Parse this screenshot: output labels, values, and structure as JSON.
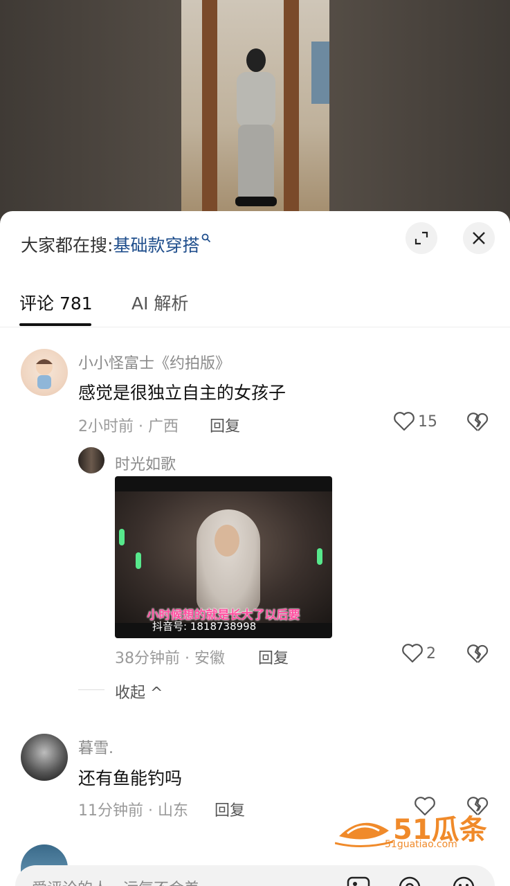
{
  "search_hint": {
    "prefix": "大家都在搜:",
    "term": "基础款穿搭"
  },
  "tabs": [
    {
      "label": "评论 781",
      "active": true
    },
    {
      "label": "AI 解析",
      "active": false
    }
  ],
  "comments": [
    {
      "username": "小小怪富士《约拍版》",
      "text": "感觉是很独立自主的女孩子",
      "meta": "2小时前 · 广西",
      "reply_label": "回复",
      "likes": "15"
    },
    {
      "username": "暮雪.",
      "text": "还有鱼能钓吗",
      "meta": "11分钟前 · 山东",
      "reply_label": "回复",
      "likes": ""
    }
  ],
  "reply": {
    "username": "时光如歌",
    "image_subtitle": "小时候想的就是长大了以后要",
    "image_watermark": "抖音号: 1818738998",
    "meta": "38分钟前 · 安徽",
    "reply_label": "回复",
    "likes": "2"
  },
  "collapse_label": "收起 ^",
  "input_placeholder": "爱评论的人，运气不会差",
  "watermark_logo": {
    "big": "51瓜条",
    "url": "51guatiao.com"
  },
  "colors": {
    "link_blue": "#1f4e8c",
    "logo_orange": "#f08a2a"
  }
}
